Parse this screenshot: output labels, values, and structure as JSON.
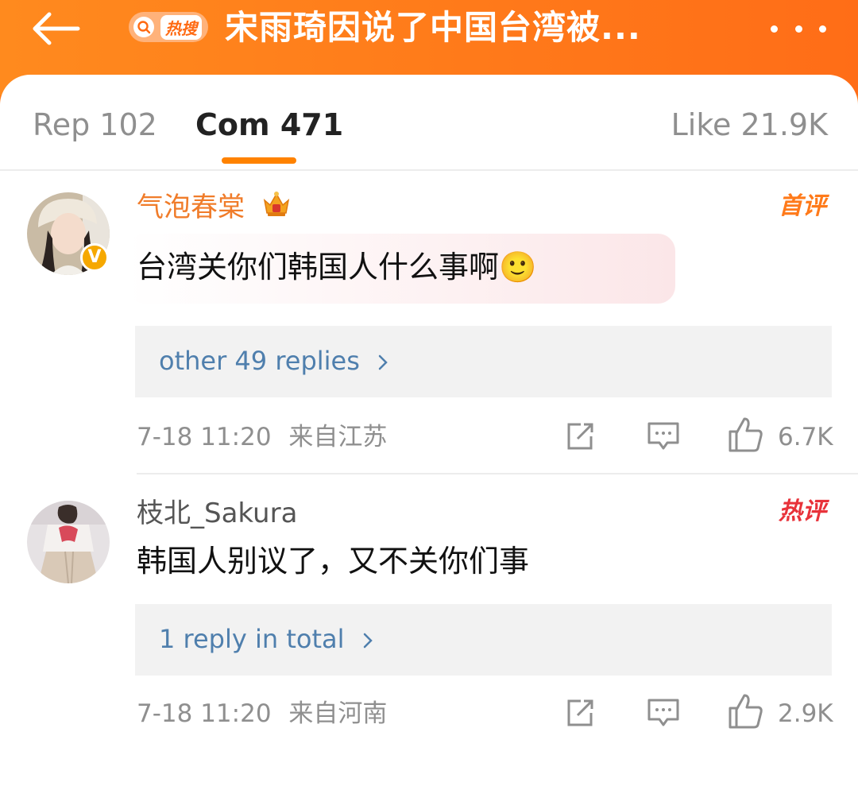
{
  "header": {
    "title": "宋雨琦因说了中国台湾被...",
    "hot_search_label": "热搜",
    "back_icon": "back-arrow-icon",
    "more_icon": "more-dots-icon"
  },
  "tabs": [
    {
      "label": "Rep 102",
      "active": false
    },
    {
      "label": "Com 471",
      "active": true
    },
    {
      "label": "Like 21.9K",
      "active": false
    }
  ],
  "colors": {
    "accent": "#ff8200",
    "header": "#ff7a1a",
    "link": "#4f7fad",
    "muted": "#8f8f8f",
    "username_orange": "#f07c2a",
    "badge_gold": "#f6a800"
  },
  "comments": [
    {
      "username": "气泡春棠",
      "content": "台湾关你们韩国人什么事啊🙂",
      "badge": "首评",
      "verified": true,
      "replies_label": "other 49 replies",
      "time": "7-18 11:20",
      "location": "来自江苏",
      "likes": "6.7K"
    },
    {
      "username": "枝北_Sakura",
      "content": "韩国人别议了，又不关你们事",
      "badge": "热评",
      "verified": false,
      "replies_label": "1 reply in total",
      "time": "7-18 11:20",
      "location": "来自河南",
      "likes": "2.9K"
    }
  ]
}
